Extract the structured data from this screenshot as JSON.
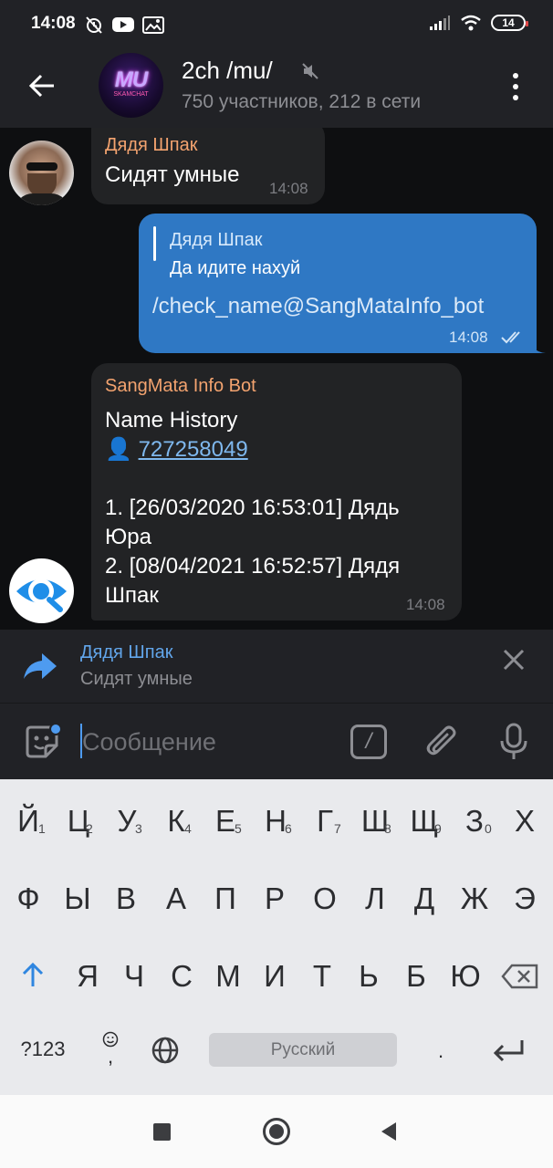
{
  "status_bar": {
    "time": "14:08",
    "battery": "14"
  },
  "header": {
    "title": "2ch /mu/",
    "subtitle": "750 участников, 212 в сети",
    "avatar_text": "MU",
    "avatar_subtext": "SKAMCHAT"
  },
  "messages": [
    {
      "sender": "Дядя Шпак",
      "text": "Сидят умные",
      "time": "14:08"
    },
    {
      "reply_to": {
        "name": "Дядя Шпак",
        "text": "Да идите нахуй"
      },
      "text": "/check_name@SangMataInfo_bot",
      "time": "14:08"
    },
    {
      "sender": "SangMata Info Bot",
      "heading": "Name History",
      "user_icon": "👤",
      "user_id": "727258049",
      "lines": [
        "1. [26/03/2020 16:53:01] Дядь",
        "Юра",
        "2. [08/04/2021 16:52:57] Дядя",
        "Шпак"
      ],
      "time": "14:08"
    }
  ],
  "reply_preview": {
    "name": "Дядя Шпак",
    "text": "Сидят умные"
  },
  "input": {
    "placeholder": "Сообщение",
    "command_label": "/"
  },
  "keyboard": {
    "row1": [
      "Й",
      "Ц",
      "У",
      "К",
      "Е",
      "Н",
      "Г",
      "Ш",
      "Щ",
      "З",
      "Х"
    ],
    "row1_nums": [
      "1",
      "2",
      "3",
      "4",
      "5",
      "6",
      "7",
      "8",
      "9",
      "0"
    ],
    "row2": [
      "Ф",
      "Ы",
      "В",
      "А",
      "П",
      "Р",
      "О",
      "Л",
      "Д",
      "Ж",
      "Э"
    ],
    "row3": [
      "Я",
      "Ч",
      "С",
      "М",
      "И",
      "Т",
      "Ь",
      "Б",
      "Ю"
    ],
    "sym_key": "?123",
    "comma_key": ",",
    "space_label": "Русский",
    "period_key": "."
  },
  "colors": {
    "accent": "#2f78c4",
    "sender_name": "#f3a36f",
    "link": "#7fb8ee",
    "background": "#0e0f11"
  }
}
